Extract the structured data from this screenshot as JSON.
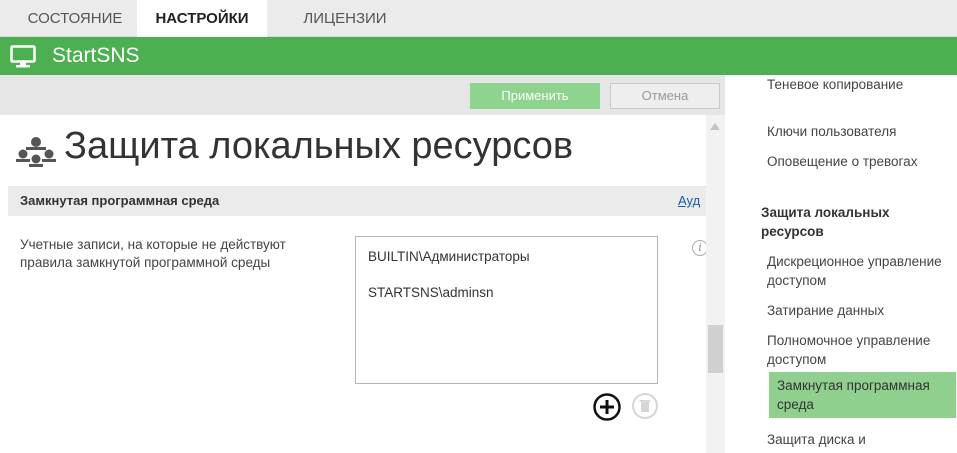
{
  "tabs": [
    {
      "label": "СОСТОЯНИЕ"
    },
    {
      "label": "НАСТРОЙКИ"
    },
    {
      "label": "ЛИЦЕНЗИИ"
    }
  ],
  "app": {
    "title": "StartSNS"
  },
  "toolbar": {
    "apply_label": "Применить",
    "cancel_label": "Отмена"
  },
  "page": {
    "title": "Защита локальных ресурсов"
  },
  "section": {
    "title": "Замкнутая программная среда",
    "link": "Ауд"
  },
  "field": {
    "label": "Учетные записи, на которые не действуют правила замкнутой программной среды",
    "items": [
      "BUILTIN\\Администраторы",
      "STARTSNS\\adminsn"
    ]
  },
  "nav": {
    "items": [
      {
        "label": "Теневое копирование"
      },
      {
        "label": "Ключи пользователя"
      },
      {
        "label": "Оповещение о тревогах"
      },
      {
        "label": "Защита локальных ресурсов"
      },
      {
        "label": "Дискреционное управление доступом"
      },
      {
        "label": "Затирание данных"
      },
      {
        "label": "Полномочное управление доступом"
      },
      {
        "label": "Замкнутая программная среда"
      },
      {
        "label": "Защита диска и"
      }
    ]
  },
  "colors": {
    "accent": "#4caf50",
    "selected": "#8fd08f",
    "link": "#1a5aa8"
  }
}
